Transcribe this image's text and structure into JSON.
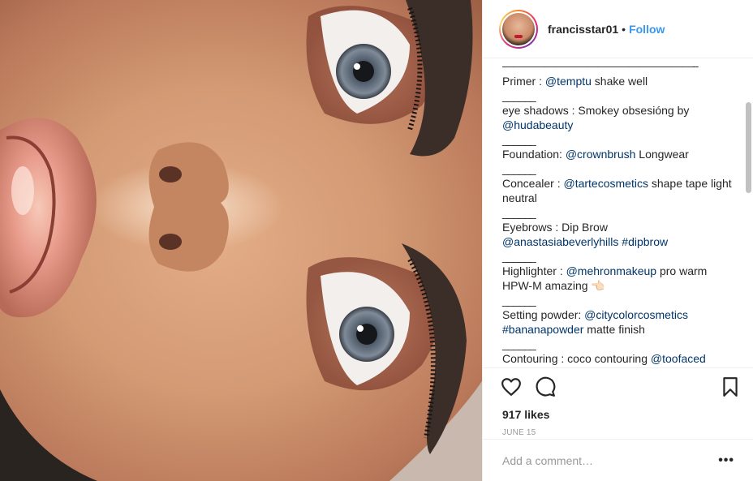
{
  "header": {
    "username": "francisstar01",
    "dot": "•",
    "follow_label": "Follow"
  },
  "caption": {
    "top_rule": "——————————————————--",
    "entries": [
      {
        "before": "Primer : ",
        "mention": "@temptu",
        "after": " shake well"
      },
      {
        "before": "eye shadows : Smokey obsesióng by ",
        "mention": "@hudabeauty",
        "after": ""
      },
      {
        "before": "Foundation: ",
        "mention": "@crownbrush",
        "after": " Longwear"
      },
      {
        "before": "Concealer : ",
        "mention": "@tartecosmetics",
        "after": " shape tape light neutral"
      },
      {
        "before": "Eyebrows : Dip Brow ",
        "mention": "@anastasiabeverlyhills",
        "mention2": "#dipbrow",
        "after": ""
      },
      {
        "before": "Highlighter : ",
        "mention": "@mehronmakeup",
        "after": " pro warm HPW-M amazing 👈🏻"
      },
      {
        "before": "Setting powder: ",
        "mention": "@citycolorcosmetics",
        "mention2": "#bananapowder",
        "after": " matte finish"
      },
      {
        "before": "Contouring : coco contouring ",
        "mention": "@toofaced",
        "after": ""
      }
    ],
    "separator": "______"
  },
  "actions": {
    "likes": "917 likes",
    "date": "JUNE 15"
  },
  "comment": {
    "placeholder": "Add a comment…",
    "more": "•••"
  },
  "icons": {
    "like": "heart-icon",
    "comment": "comment-bubble-icon",
    "save": "bookmark-icon",
    "more": "more-options-icon"
  },
  "colors": {
    "link": "#003569",
    "follow": "#3897f0",
    "muted": "#999999",
    "border": "#efefef"
  }
}
